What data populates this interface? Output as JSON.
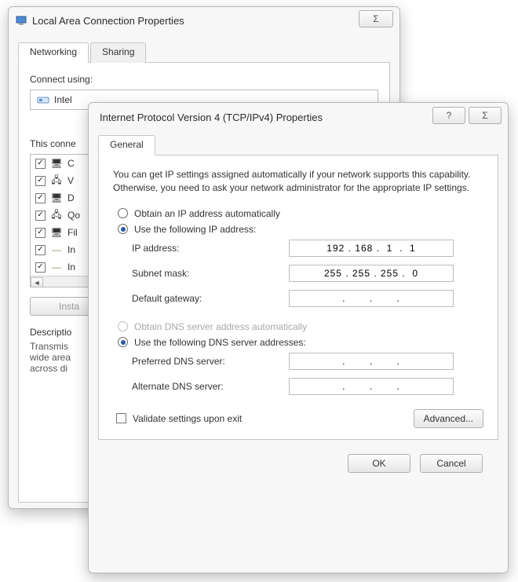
{
  "lac": {
    "title": "Local Area Connection Properties",
    "close_glyph": "Σ",
    "tabs": {
      "networking": "Networking",
      "sharing": "Sharing"
    },
    "connect_using_label": "Connect using:",
    "adapter_name": "Intel",
    "items_label": "This conne",
    "items": [
      {
        "checked": true,
        "label": "C"
      },
      {
        "checked": true,
        "label": "V"
      },
      {
        "checked": true,
        "label": "D"
      },
      {
        "checked": true,
        "label": "Qo"
      },
      {
        "checked": true,
        "label": "Fil"
      },
      {
        "checked": true,
        "label": "In"
      },
      {
        "checked": true,
        "label": "In"
      }
    ],
    "install_btn": "Insta",
    "description_hdr": "Descriptio",
    "description_body": "Transmis\nwide area\nacross di"
  },
  "ipv4": {
    "title": "Internet Protocol Version 4 (TCP/IPv4) Properties",
    "help_glyph": "?",
    "close_glyph": "Σ",
    "tab_general": "General",
    "info": "You can get IP settings assigned automatically if your network supports this capability. Otherwise, you need to ask your network administrator for the appropriate IP settings.",
    "radio_auto_ip": "Obtain an IP address automatically",
    "radio_manual_ip": "Use the following IP address:",
    "ip_addr_label": "IP address:",
    "ip_addr_value": "192 . 168 .  1  .  1",
    "subnet_label": "Subnet mask:",
    "subnet_value": "255 . 255 . 255 .  0",
    "gateway_label": "Default gateway:",
    "gateway_value": ".       .       .",
    "radio_auto_dns": "Obtain DNS server address automatically",
    "radio_manual_dns": "Use the following DNS server addresses:",
    "pref_dns_label": "Preferred DNS server:",
    "pref_dns_value": ".       .       .",
    "alt_dns_label": "Alternate DNS server:",
    "alt_dns_value": ".       .       .",
    "validate_label": "Validate settings upon exit",
    "advanced_btn": "Advanced...",
    "ok_btn": "OK",
    "cancel_btn": "Cancel"
  }
}
